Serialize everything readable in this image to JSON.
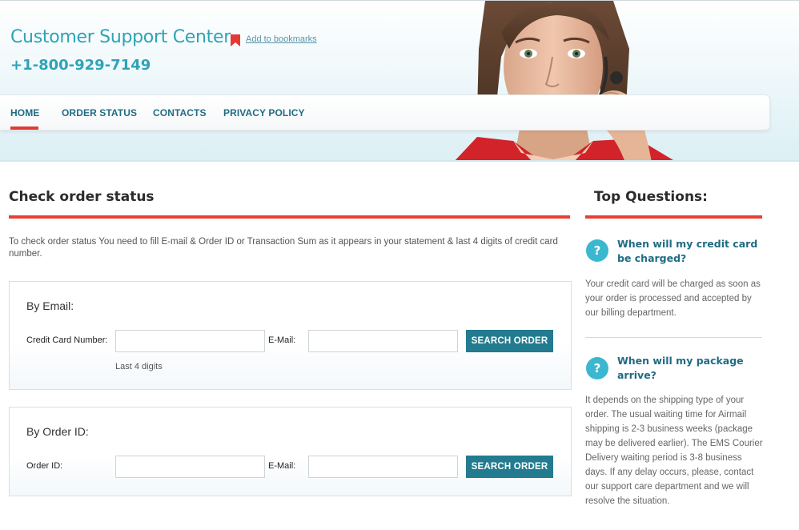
{
  "header": {
    "site_title": "Customer Support Center",
    "bookmark_link": "Add to bookmarks",
    "phone": "+1-800-929-7149"
  },
  "nav": {
    "items": [
      {
        "label": "HOME",
        "active": true
      },
      {
        "label": "ORDER STATUS",
        "active": false
      },
      {
        "label": "CONTACTS",
        "active": false
      },
      {
        "label": "PRIVACY POLICY",
        "active": false
      }
    ]
  },
  "main": {
    "title": "Check order status",
    "intro": "To check order status You need to fill E-mail & Order ID or Transaction Sum as it appears in your statement & last 4 digits of credit card number.",
    "by_email": {
      "heading": "By Email:",
      "card_label": "Credit Card Number:",
      "card_value": "",
      "card_hint": "Last 4 digits",
      "email_label": "E-Mail:",
      "email_value": "",
      "button": "SEARCH ORDER"
    },
    "by_order": {
      "heading": "By Order ID:",
      "order_label": "Order ID:",
      "order_value": "",
      "email_label": "E-Mail:",
      "email_value": "",
      "button": "SEARCH ORDER"
    }
  },
  "sidebar": {
    "title": "Top Questions:",
    "questions": [
      {
        "icon": "?",
        "title": "When will my credit card be charged?",
        "answer": "Your credit card will be charged as soon as your order is processed and accepted by our billing department."
      },
      {
        "icon": "?",
        "title": "When will my package arrive?",
        "answer": "It depends on the shipping type of your order. The usual waiting time for Airmail shipping is 2-3 business weeks (package may be delivered earlier). The EMS Courier Delivery waiting period is 3-8 business days. If any delay occurs, please, contact our support care department and we will resolve the situation."
      }
    ]
  },
  "colors": {
    "accent_red": "#e8412f",
    "brand_teal": "#2ea3b6",
    "nav_text": "#1f6c84",
    "button_bg": "#237b8f",
    "question_icon": "#3bb7cf"
  }
}
